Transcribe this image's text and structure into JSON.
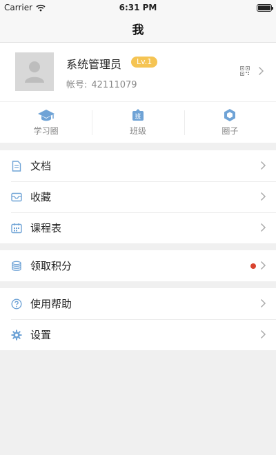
{
  "status_bar": {
    "carrier": "Carrier",
    "time": "6:31 PM"
  },
  "nav": {
    "title": "我"
  },
  "profile": {
    "name": "系统管理员",
    "level": "Lv.1",
    "account_label": "帐号:",
    "account_id": "42111079"
  },
  "quick_links": [
    {
      "label": "学习圈",
      "icon": "graduation-cap-icon"
    },
    {
      "label": "班级",
      "icon": "class-icon"
    },
    {
      "label": "圈子",
      "icon": "hexagon-icon"
    }
  ],
  "menu": {
    "group1": [
      {
        "label": "文档",
        "icon": "document-icon"
      },
      {
        "label": "收藏",
        "icon": "inbox-icon"
      },
      {
        "label": "课程表",
        "icon": "calendar-icon"
      }
    ],
    "group2": [
      {
        "label": "领取积分",
        "icon": "coin-stack-icon",
        "has_dot": true
      }
    ],
    "group3": [
      {
        "label": "使用帮助",
        "icon": "help-icon"
      },
      {
        "label": "设置",
        "icon": "gear-icon"
      }
    ]
  },
  "colors": {
    "accent": "#6fa3d6",
    "badge": "#f5c453",
    "dot": "#d9432f"
  }
}
